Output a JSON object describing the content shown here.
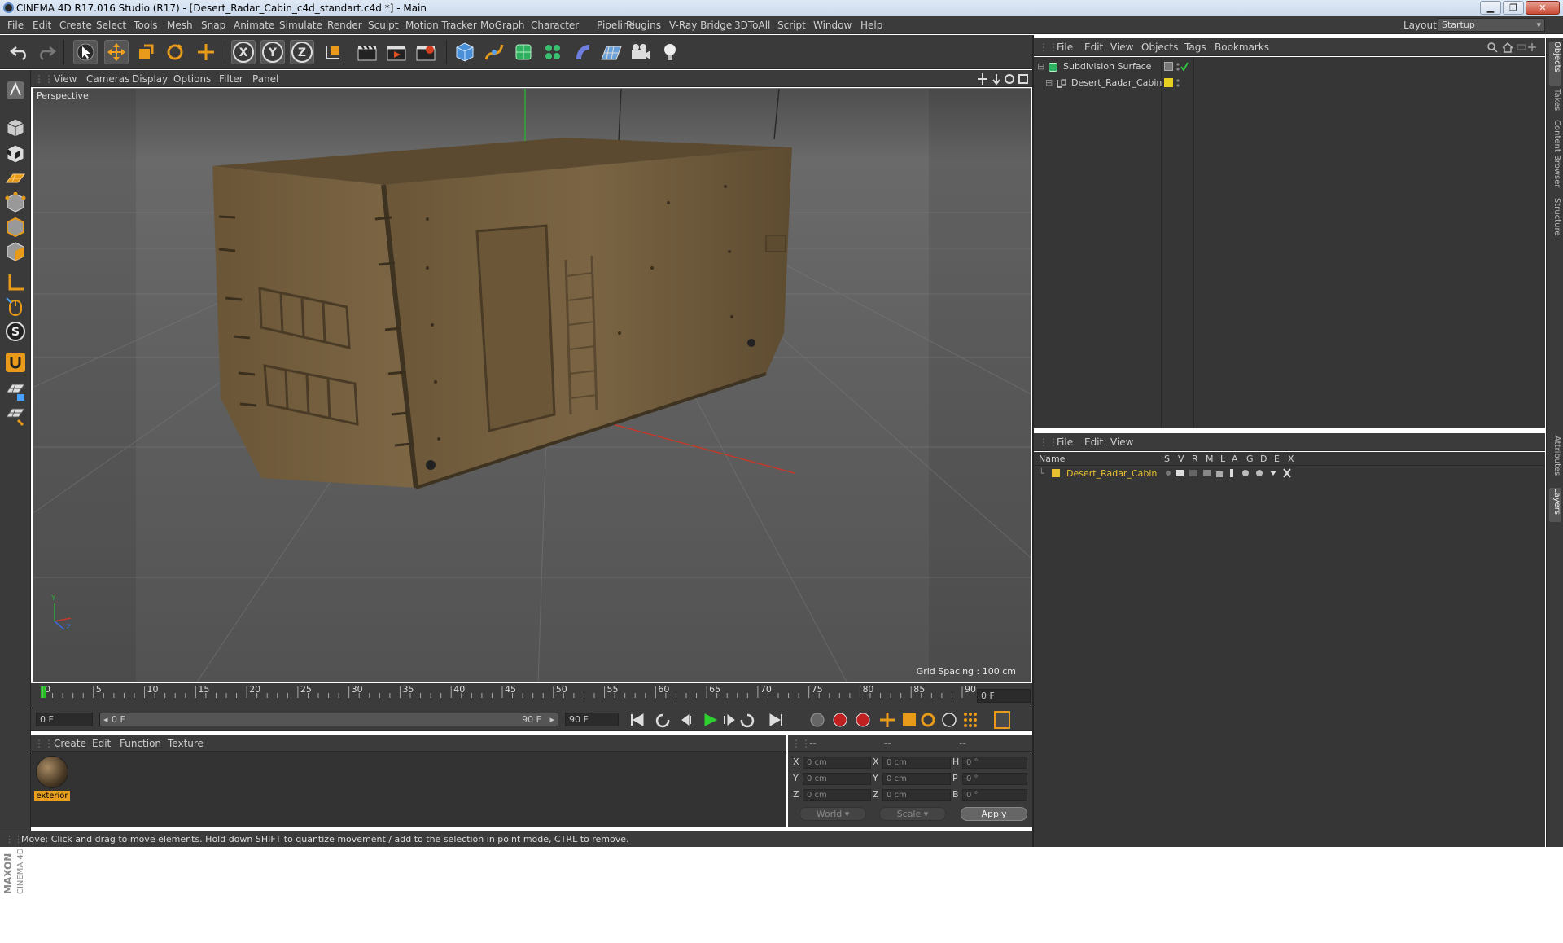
{
  "window": {
    "title": "CINEMA 4D R17.016 Studio (R17) - [Desert_Radar_Cabin_c4d_standart.c4d *] - Main",
    "controls": [
      "▁",
      "❐",
      "✕"
    ]
  },
  "menubar": {
    "items": [
      "File",
      "Edit",
      "Create",
      "Select",
      "Tools",
      "Mesh",
      "Snap",
      "Animate",
      "Simulate",
      "Render",
      "Sculpt",
      "Motion Tracker",
      "MoGraph",
      "Character",
      "Pipeline",
      "Plugins",
      "V-Ray Bridge",
      "3DToAll",
      "Script",
      "Window",
      "Help"
    ],
    "layout_label": "Layout:",
    "layout_value": "Startup"
  },
  "toolbar": {
    "axis_x": "X",
    "axis_y": "Y",
    "axis_z": "Z"
  },
  "viewport": {
    "menu": [
      "View",
      "Cameras",
      "Display",
      "Options",
      "Filter",
      "Panel"
    ],
    "camera_label": "Perspective",
    "grid_spacing": "Grid Spacing : 100 cm",
    "axis_labels": {
      "y": "Y",
      "z": "Z"
    }
  },
  "timeline": {
    "ticks": [
      "0",
      "5",
      "10",
      "15",
      "20",
      "25",
      "30",
      "35",
      "40",
      "45",
      "50",
      "55",
      "60",
      "65",
      "70",
      "75",
      "80",
      "85",
      "90"
    ],
    "current_frame": "0 F",
    "start_frame": "0 F",
    "range_start": "0 F",
    "range_end": "90 F",
    "end_frame": "90 F"
  },
  "material_manager": {
    "menu": [
      "Create",
      "Edit",
      "Function",
      "Texture"
    ],
    "materials": [
      {
        "name": "exterior"
      }
    ]
  },
  "coordinates": {
    "headers": [
      "--",
      "--",
      "--"
    ],
    "rows": [
      {
        "a": "X",
        "av": "0 cm",
        "b": "X",
        "bv": "0 cm",
        "c": "H",
        "cv": "0 °"
      },
      {
        "a": "Y",
        "av": "0 cm",
        "b": "Y",
        "bv": "0 cm",
        "c": "P",
        "cv": "0 °"
      },
      {
        "a": "Z",
        "av": "0 cm",
        "b": "Z",
        "bv": "0 cm",
        "c": "B",
        "cv": "0 °"
      }
    ],
    "space": "World",
    "mode": "Scale",
    "apply": "Apply"
  },
  "status": "Move: Click and drag to move elements. Hold down SHIFT to quantize movement / add to the selection in point mode, CTRL to remove.",
  "object_manager": {
    "menu": [
      "File",
      "Edit",
      "View",
      "Objects",
      "Tags",
      "Bookmarks"
    ],
    "objects": [
      {
        "name": "Subdivision Surface"
      },
      {
        "name": "Desert_Radar_Cabin"
      }
    ]
  },
  "layer_manager": {
    "menu": [
      "File",
      "Edit",
      "View"
    ],
    "columns": [
      "Name",
      "S",
      "V",
      "R",
      "M",
      "L",
      "A",
      "G",
      "D",
      "E",
      "X"
    ],
    "layers": [
      {
        "name": "Desert_Radar_Cabin",
        "color": "#e8c030"
      }
    ]
  },
  "right_tabs": [
    "Objects",
    "Takes",
    "Content Browser",
    "Structure",
    "Attributes",
    "Layers"
  ],
  "branding": {
    "maxon": "MAXON",
    "c4d": "CINEMA 4D"
  },
  "colors": {
    "accent": "#e89f1e",
    "panel": "#3b3b3b",
    "viewport": "#5a5a5a"
  }
}
